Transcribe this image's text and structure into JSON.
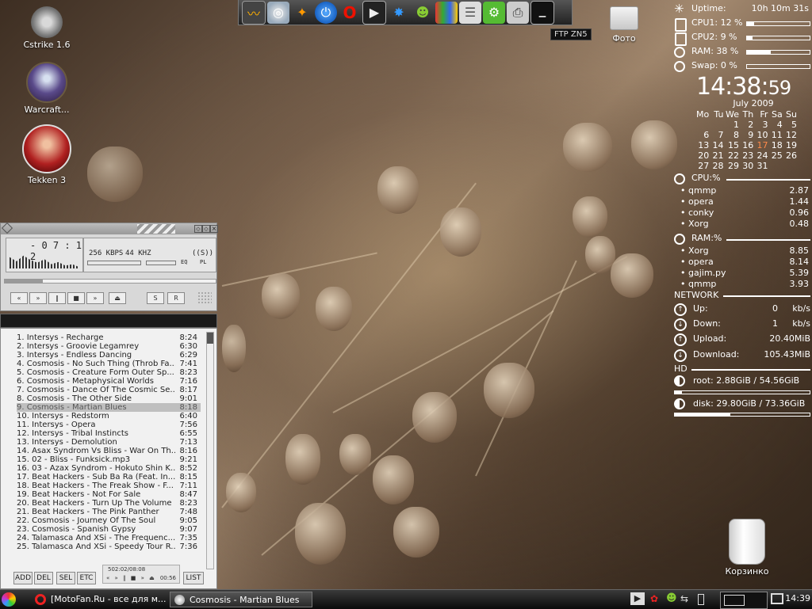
{
  "desktop": {
    "icons": [
      {
        "label": "Cstrike 1.6",
        "icon": "counter-strike-icon"
      },
      {
        "label": "Warcraft...",
        "icon": "warcraft-icon"
      },
      {
        "label": "Tekken 3",
        "icon": "tekken-icon"
      },
      {
        "label": "Фото",
        "icon": "folder-icon"
      },
      {
        "label": "Корзинко",
        "icon": "trash-icon"
      }
    ]
  },
  "launcher": {
    "tooltip": "FTP ZN5",
    "items": [
      "audio-waveform-icon",
      "disk-icon",
      "tools-icon",
      "power-icon",
      "opera-icon",
      "media-play-icon",
      "network-icon",
      "user-icon",
      "colors-icon",
      "files-icon",
      "utility-icon",
      "printer-icon",
      "terminal-icon"
    ]
  },
  "conky": {
    "uptime_label": "Uptime:",
    "uptime_value": "10h 10m 31s",
    "cpu1_label": "CPU1: 12 %",
    "cpu1_pct": 12,
    "cpu2_label": "CPU2:  9 %",
    "cpu2_pct": 9,
    "ram_label": "RAM: 38 %",
    "ram_pct": 38,
    "swap_label": "Swap:  0  %",
    "swap_pct": 0,
    "time_hm": "14:38:",
    "time_s": "59",
    "month": "July  2009",
    "weekdays": [
      "Mo",
      "Tu",
      "We",
      "Th",
      "Fr",
      "Sa",
      "Su"
    ],
    "weeks": [
      [
        "",
        "",
        "",
        "1",
        "2",
        "3",
        "4",
        "5"
      ],
      [
        "6",
        "7",
        "8",
        "9",
        "10",
        "11",
        "12"
      ],
      [
        "13",
        "14",
        "15",
        "16",
        "17",
        "18",
        "19"
      ],
      [
        "20",
        "21",
        "22",
        "23",
        "24",
        "25",
        "26"
      ],
      [
        "27",
        "28",
        "29",
        "30",
        "31",
        "",
        ""
      ]
    ],
    "today": "17",
    "cpu_section": "CPU:%",
    "cpu_procs": [
      {
        "name": "qmmp",
        "value": "2.87"
      },
      {
        "name": "opera",
        "value": "1.44"
      },
      {
        "name": "conky",
        "value": "0.96"
      },
      {
        "name": "Xorg",
        "value": "0.48"
      }
    ],
    "ram_section": "RAM:%",
    "ram_procs": [
      {
        "name": "Xorg",
        "value": "8.85"
      },
      {
        "name": "opera",
        "value": "8.14"
      },
      {
        "name": "gajim.py",
        "value": "5.39"
      },
      {
        "name": "qmmp",
        "value": "3.93"
      }
    ],
    "network_label": "NETWORK",
    "up_label": "Up:",
    "up_value": "0",
    "up_unit": "kb/s",
    "down_label": "Down:",
    "down_value": "1",
    "down_unit": "kb/s",
    "upload_label": "Upload:",
    "upload_value": "20.40MiB",
    "download_label": "Download:",
    "download_value": "105.43MiB",
    "hd_label": "HD",
    "root_label": "root:  2.88GiB  / 54.56GiB",
    "root_pct": 5,
    "disk_label": "disk: 29.80GiB / 73.36GiB",
    "disk_pct": 41
  },
  "player": {
    "time": "- 0 7 : 1 2",
    "bitrate": "256 KBPS",
    "samplerate": "44 KHZ",
    "stereo": "((S))",
    "eq_label": "EQ",
    "pl_label": "PL",
    "buttons": [
      "«",
      "»",
      "‖",
      "■",
      "»",
      "⏏"
    ],
    "shuffle": "S",
    "repeat": "R",
    "progress": 0.18
  },
  "playlist": {
    "tracks": [
      {
        "title": "1. Intersys - Recharge",
        "dur": "8:24"
      },
      {
        "title": "2. Intersys - Groovie Legamrey",
        "dur": "6:30"
      },
      {
        "title": "3. Intersys - Endless Dancing",
        "dur": "6:29"
      },
      {
        "title": "4. Cosmosis - No Such Thing (Throb Fa...",
        "dur": "7:41"
      },
      {
        "title": "5. Cosmosis - Creature Form Outer Sp...",
        "dur": "8:23"
      },
      {
        "title": "6. Cosmosis - Metaphysical Worlds",
        "dur": "7:16"
      },
      {
        "title": "7. Cosmosis - Dance Of The Cosmic Se...",
        "dur": "8:17"
      },
      {
        "title": "8. Cosmosis - The Other Side",
        "dur": "9:01"
      },
      {
        "title": "9. Cosmosis - Martian Blues",
        "dur": "8:18"
      },
      {
        "title": "10. Intersys - Redstorm",
        "dur": "6:40"
      },
      {
        "title": "11. Intersys - Opera",
        "dur": "7:56"
      },
      {
        "title": "12. Intersys - Tribal Instincts",
        "dur": "6:55"
      },
      {
        "title": "13. Intersys - Demolution",
        "dur": "7:13"
      },
      {
        "title": "14. Asax Syndrom Vs Bliss - War On Th...",
        "dur": "8:16"
      },
      {
        "title": "15. 02 - Bliss - Funksick.mp3",
        "dur": "9:21"
      },
      {
        "title": "16. 03 - Azax Syndrom - Hokuto Shin K...",
        "dur": "8:52"
      },
      {
        "title": "17. Beat Hackers - Sub Ba Ra (Feat. In...",
        "dur": "8:15"
      },
      {
        "title": "18. Beat Hackers - The Freak Show - F...",
        "dur": "7:11"
      },
      {
        "title": "19. Beat Hackers - Not For Sale",
        "dur": "8:47"
      },
      {
        "title": "20. Beat Hackers - Turn Up The Volume",
        "dur": "8:23"
      },
      {
        "title": "21. Beat Hackers - The Pink Panther",
        "dur": "7:48"
      },
      {
        "title": "22. Cosmosis - Journey Of The Soul",
        "dur": "9:05"
      },
      {
        "title": "23. Cosmosis - Spanish Gypsy",
        "dur": "9:07"
      },
      {
        "title": "24. Talamasca And XSi - The Frequenc...",
        "dur": "7:35"
      },
      {
        "title": "25. Talamasca And XSi - Speedy Tour R...",
        "dur": "7:36"
      }
    ],
    "selected": 9,
    "buttons": {
      "add": "ADD",
      "del": "DEL",
      "sel": "SEL",
      "etc": "ETC",
      "list": "LIST"
    },
    "info": "502:02/08:08",
    "mini_time": "00:56"
  },
  "taskbar": {
    "task1": "[MotoFan.Ru - все для м...",
    "task2": "Cosmosis - Martian Blues",
    "clock": "14:39"
  }
}
